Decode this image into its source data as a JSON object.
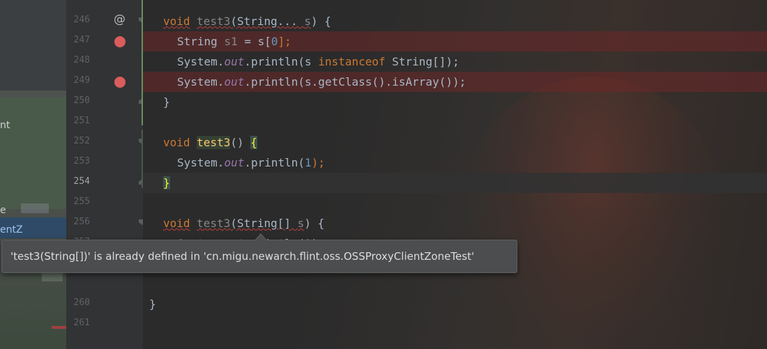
{
  "left_panel": {
    "fragments": [
      {
        "text": "nt",
        "selected": false
      },
      {
        "text": "e",
        "selected": false
      },
      {
        "text": "entZ",
        "selected": true
      }
    ]
  },
  "gutter": {
    "line_numbers": [
      "246",
      "247",
      "248",
      "249",
      "250",
      "251",
      "252",
      "253",
      "254",
      "255",
      "256",
      "257",
      "",
      "",
      "260",
      "261"
    ]
  },
  "code": {
    "l246": {
      "kw": "void",
      "name": "test3",
      "rest": "(String... ",
      "param": "s",
      "close": ") {"
    },
    "l247": {
      "type": "String ",
      "var": "s1",
      "eq": " = s[",
      "idx": "0",
      "end": "];"
    },
    "l248": {
      "sys": "System.",
      "out": "out",
      "call": ".println(s ",
      "kw": "instanceof",
      "rest": " String[]);"
    },
    "l249": {
      "sys": "System.",
      "out": "out",
      "call": ".println(s.getClass().isArray());"
    },
    "l250": {
      "text": "}"
    },
    "l252": {
      "kw": "void",
      "name": "test3",
      "paren": "() ",
      "brace": "{"
    },
    "l253": {
      "sys": "System.",
      "out": "out",
      "call": ".println(",
      "num": "1",
      "end": ");"
    },
    "l254": {
      "brace": "}"
    },
    "l256": {
      "kw": "void",
      "name": "test3",
      "rest": "(String[] ",
      "param": "s",
      "close": ") {"
    },
    "l257": {
      "text": "System.out.println(2);"
    },
    "l260": {
      "text": "}"
    }
  },
  "tooltip": {
    "message": "'test3(String[])' is already defined in 'cn.migu.newarch.flint.oss.OSSProxyClientZoneTest'"
  },
  "colors": {
    "keyword": "#cc7832",
    "method_decl": "#ffc66d",
    "static_field": "#9876aa",
    "number": "#6897bb",
    "breakpoint": "#db5c5c",
    "editor_bg": "#2b2b2b"
  }
}
